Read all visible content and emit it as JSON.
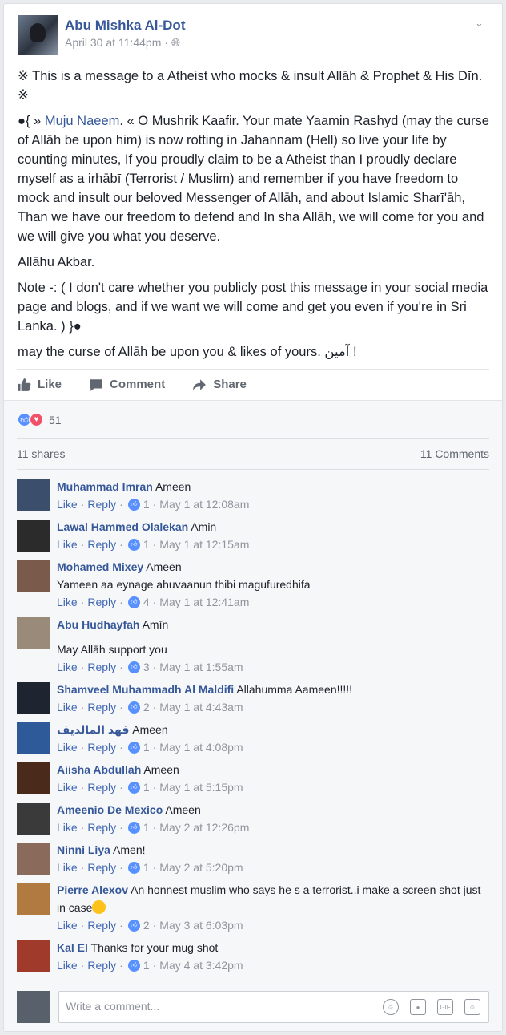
{
  "post": {
    "author": "Abu Mishka Al-Dot",
    "timestamp": "April 30 at 11:44pm",
    "privacy_icon": "globe-icon",
    "paragraphs": [
      "※ This is a message to a Atheist who mocks & insult Allāh & Prophet & His Dīn. ※",
      "Allāhu Akbar.",
      "Note -: ( I don't care whether you publicly post this message in your social media page and blogs, and if we want we will come and get you even if you're in Sri Lanka. ) }●",
      "may the curse of Allāh be upon you & likes of yours. آمين !"
    ],
    "mention_prefix": "●{ » ",
    "mention_name": "Muju Naeem",
    "mention_text": ". « O Mushrik Kaafir. Your mate Yaamin Rashyd (may the curse of Allāh be upon him) is now rotting in Jahannam (Hell) so live your life by counting minutes, If you proudly claim to be a Atheist than I proudly declare myself as a irhābī (Terrorist / Muslim) and remember if you have freedom to mock and insult our beloved Messenger of Allāh, and about Islamic Sharī'āh, Than we have our freedom to defend and In sha Allāh, we will come for you and we will give you what you deserve."
  },
  "actions": {
    "like": "Like",
    "comment": "Comment",
    "share": "Share"
  },
  "reactions": {
    "count": "51"
  },
  "stats": {
    "shares": "11 shares",
    "comments": "11 Comments"
  },
  "comments": [
    {
      "name": "Muhammad Imran",
      "text": "Ameen",
      "extra": "",
      "likes": "1",
      "time": "May 1 at 12:08am"
    },
    {
      "name": "Lawal Hammed Olalekan",
      "text": "Amin",
      "extra": "",
      "likes": "1",
      "time": "May 1 at 12:15am"
    },
    {
      "name": "Mohamed Mixey",
      "text": "Ameen",
      "extra": "Yameen aa eynage ahuvaanun thibi magufuredhifa",
      "likes": "4",
      "time": "May 1 at 12:41am"
    },
    {
      "name": "Abu Hudhayfah",
      "text": "Amīn",
      "extra": "May Allāh support you",
      "likes": "3",
      "time": "May 1 at 1:55am"
    },
    {
      "name": "Shamveel Muhammadh Al Maldifi",
      "text": "Allahumma Aameen!!!!!",
      "extra": "",
      "likes": "2",
      "time": "May 1 at 4:43am"
    },
    {
      "name": "فهد المالديف",
      "text": "Ameen",
      "extra": "",
      "likes": "1",
      "time": "May 1 at 4:08pm"
    },
    {
      "name": "Aiisha Abdullah",
      "text": "Ameen",
      "extra": "",
      "likes": "1",
      "time": "May 1 at 5:15pm"
    },
    {
      "name": "Ameenio De Mexico",
      "text": "Ameen",
      "extra": "",
      "likes": "1",
      "time": "May 2 at 12:26pm"
    },
    {
      "name": "Ninni Liya",
      "text": "Amen!",
      "extra": "",
      "likes": "1",
      "time": "May 2 at 5:20pm"
    },
    {
      "name": "Pierre Alexov",
      "text": "An honnest muslim who says he s a terrorist..i make a screen shot just in case",
      "extra": "",
      "likes": "2",
      "time": "May 3 at 6:03pm"
    },
    {
      "name": "Kal El",
      "text": "Thanks for your mug shot",
      "extra": "",
      "likes": "1",
      "time": "May 4 at 3:42pm"
    }
  ],
  "comment_labels": {
    "like": "Like",
    "reply": "Reply"
  },
  "write": {
    "placeholder": "Write a comment..."
  },
  "colors": {
    "link": "#365899",
    "like_blue": "#5890ff",
    "love_red": "#f25268"
  }
}
